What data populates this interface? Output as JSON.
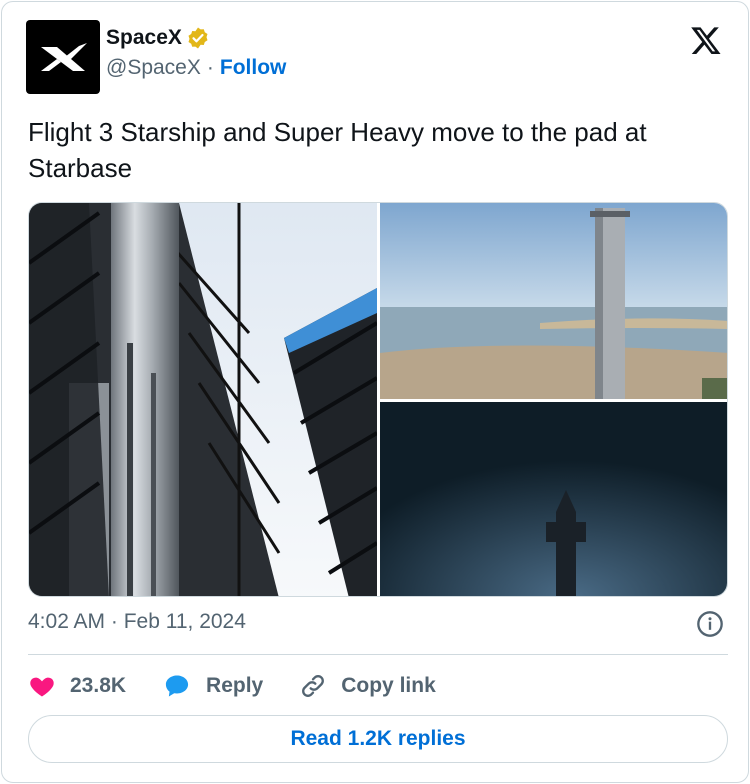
{
  "author": {
    "display_name": "SpaceX",
    "handle": "@SpaceX",
    "separator": "·",
    "follow_label": "Follow",
    "verified": true
  },
  "tweet": {
    "text": "Flight 3 Starship and Super Heavy move to the pad at Starbase",
    "timestamp": "4:02 AM · Feb 11, 2024",
    "media_count": 3
  },
  "actions": {
    "like_count": "23.8K",
    "reply_label": "Reply",
    "copy_link_label": "Copy link"
  },
  "read_replies_label": "Read 1.2K replies",
  "colors": {
    "accent": "#006fd6",
    "like": "#f91880",
    "reply": "#1d9bf0",
    "verified": "#e2b719",
    "muted": "#536471",
    "border": "#cfd9de"
  },
  "icons": [
    "spacex-logo-icon",
    "verified-badge-icon",
    "x-logo-icon",
    "info-icon",
    "heart-icon",
    "reply-bubble-icon",
    "link-icon"
  ]
}
